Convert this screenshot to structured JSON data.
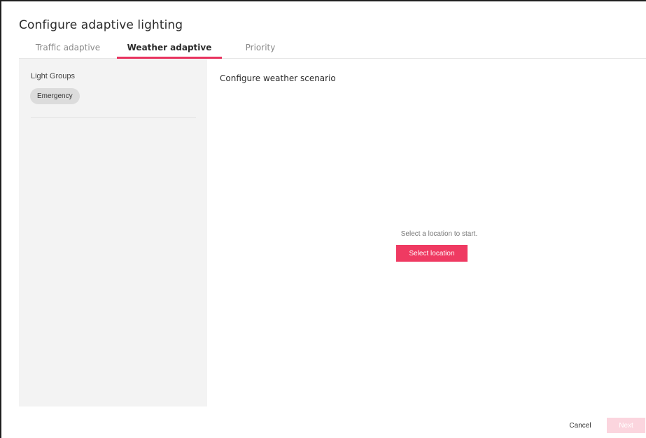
{
  "dialog": {
    "title": "Configure adaptive lighting"
  },
  "tabs": [
    {
      "label": "Traffic adaptive",
      "active": false
    },
    {
      "label": "Weather adaptive",
      "active": true
    },
    {
      "label": "Priority",
      "active": false
    }
  ],
  "sidebar": {
    "heading": "Light Groups",
    "chips": [
      {
        "label": "Emergency"
      }
    ]
  },
  "main": {
    "heading": "Configure weather scenario",
    "empty_text": "Select a location to start.",
    "select_location_label": "Select location"
  },
  "footer": {
    "cancel_label": "Cancel",
    "next_label": "Next",
    "next_enabled": false
  },
  "colors": {
    "accent": "#ef3a62",
    "tab_indicator": "#e8335f",
    "next_disabled": "#fbd5de",
    "sidebar_bg": "#f3f3f3"
  }
}
